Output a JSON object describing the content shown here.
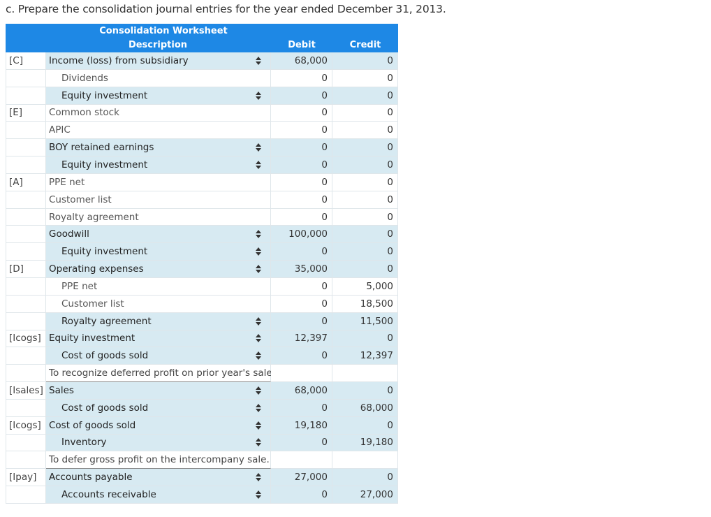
{
  "instruction": "c. Prepare the consolidation journal entries for the year ended December 31, 2013.",
  "worksheet": {
    "title": "Consolidation Worksheet",
    "col_description": "Description",
    "col_debit": "Debit",
    "col_credit": "Credit"
  },
  "rows": [
    {
      "label": "[C]",
      "desc": "Income (loss) from subsidiary",
      "indent": 1,
      "select": true,
      "debit": "68,000",
      "credit": "0",
      "shade": true
    },
    {
      "label": "",
      "desc": "Dividends",
      "indent": 2,
      "select": false,
      "debit": "0",
      "credit": "0",
      "shade": false
    },
    {
      "label": "",
      "desc": "Equity investment",
      "indent": 2,
      "select": true,
      "debit": "0",
      "credit": "0",
      "shade": true
    },
    {
      "label": "[E]",
      "desc": "Common stock",
      "indent": 1,
      "select": false,
      "debit": "0",
      "credit": "0",
      "shade": false
    },
    {
      "label": "",
      "desc": "APIC",
      "indent": 1,
      "select": false,
      "debit": "0",
      "credit": "0",
      "shade": false
    },
    {
      "label": "",
      "desc": "BOY retained earnings",
      "indent": 1,
      "select": true,
      "debit": "0",
      "credit": "0",
      "shade": true
    },
    {
      "label": "",
      "desc": "Equity investment",
      "indent": 2,
      "select": true,
      "debit": "0",
      "credit": "0",
      "shade": true
    },
    {
      "label": "[A]",
      "desc": "PPE net",
      "indent": 1,
      "select": false,
      "debit": "0",
      "credit": "0",
      "shade": false
    },
    {
      "label": "",
      "desc": "Customer list",
      "indent": 1,
      "select": false,
      "debit": "0",
      "credit": "0",
      "shade": false
    },
    {
      "label": "",
      "desc": "Royalty agreement",
      "indent": 1,
      "select": false,
      "debit": "0",
      "credit": "0",
      "shade": false
    },
    {
      "label": "",
      "desc": "Goodwill",
      "indent": 1,
      "select": true,
      "debit": "100,000",
      "credit": "0",
      "shade": true
    },
    {
      "label": "",
      "desc": "Equity investment",
      "indent": 2,
      "select": true,
      "debit": "0",
      "credit": "0",
      "shade": true
    },
    {
      "label": "[D]",
      "desc": "Operating expenses",
      "indent": 1,
      "select": true,
      "debit": "35,000",
      "credit": "0",
      "shade": true
    },
    {
      "label": "",
      "desc": "PPE net",
      "indent": 2,
      "select": false,
      "debit": "0",
      "credit": "5,000",
      "shade": false
    },
    {
      "label": "",
      "desc": "Customer list",
      "indent": 2,
      "select": false,
      "debit": "0",
      "credit": "18,500",
      "shade": false
    },
    {
      "label": "",
      "desc": "Royalty agreement",
      "indent": 2,
      "select": true,
      "debit": "0",
      "credit": "11,500",
      "shade": true
    },
    {
      "label": "[Icogs]",
      "desc": "Equity investment",
      "indent": 1,
      "select": true,
      "debit": "12,397",
      "credit": "0",
      "shade": true
    },
    {
      "label": "",
      "desc": "Cost of goods sold",
      "indent": 2,
      "select": true,
      "debit": "0",
      "credit": "12,397",
      "shade": true
    },
    {
      "label": "",
      "desc": "To recognize deferred profit on prior year's sale.",
      "note": true,
      "debit": "",
      "credit": "",
      "shade": false
    },
    {
      "label": "[Isales]",
      "desc": "Sales",
      "indent": 1,
      "select": true,
      "debit": "68,000",
      "credit": "0",
      "shade": true
    },
    {
      "label": "",
      "desc": "Cost of goods sold",
      "indent": 2,
      "select": true,
      "debit": "0",
      "credit": "68,000",
      "shade": true
    },
    {
      "label": "[Icogs]",
      "desc": "Cost of goods sold",
      "indent": 1,
      "select": true,
      "debit": "19,180",
      "credit": "0",
      "shade": true
    },
    {
      "label": "",
      "desc": "Inventory",
      "indent": 2,
      "select": true,
      "debit": "0",
      "credit": "19,180",
      "shade": true
    },
    {
      "label": "",
      "desc": "To defer gross profit on the intercompany sale.",
      "note": true,
      "debit": "",
      "credit": "",
      "shade": false
    },
    {
      "label": "[Ipay]",
      "desc": "Accounts payable",
      "indent": 1,
      "select": true,
      "debit": "27,000",
      "credit": "0",
      "shade": true
    },
    {
      "label": "",
      "desc": "Accounts receivable",
      "indent": 2,
      "select": true,
      "debit": "0",
      "credit": "27,000",
      "shade": true
    }
  ]
}
